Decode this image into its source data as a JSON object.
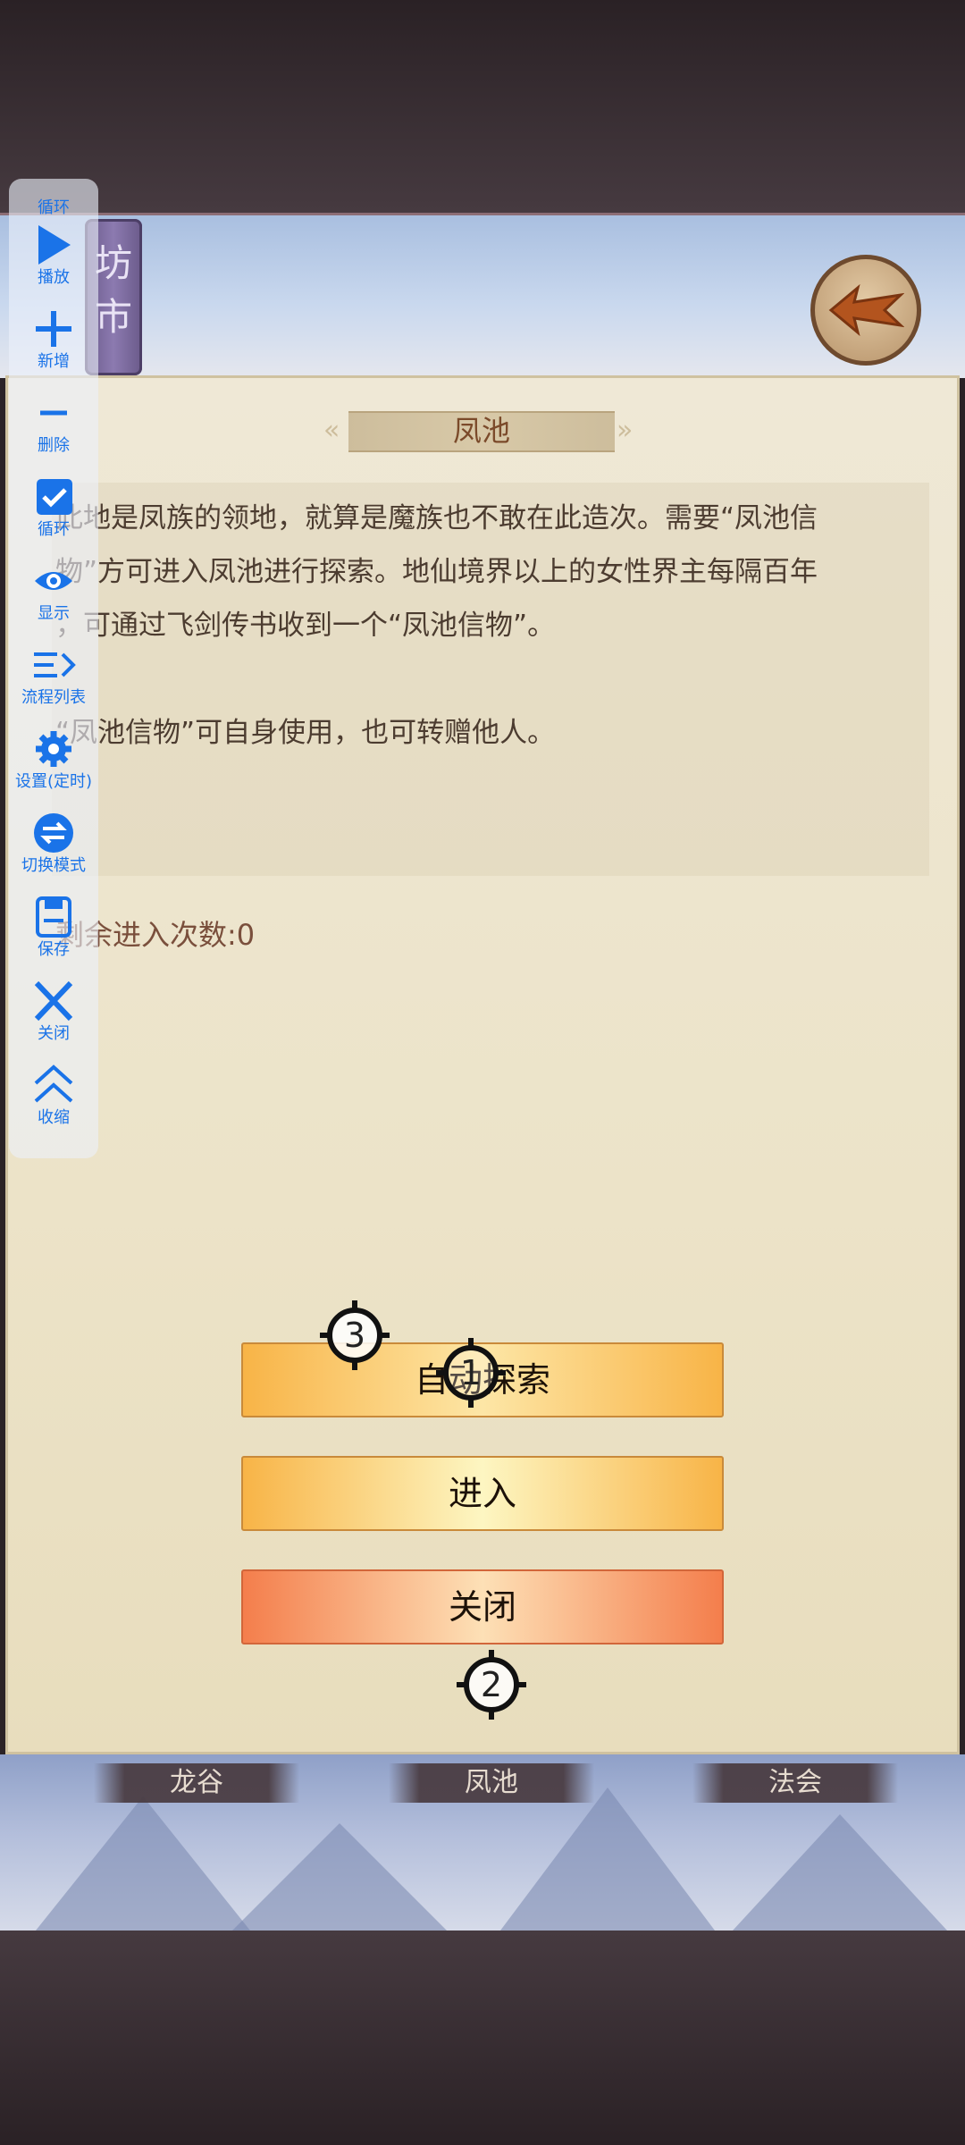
{
  "scene": {
    "shop_sign": [
      "坊",
      "市"
    ]
  },
  "panel": {
    "title": "凤池",
    "description_lines": [
      "此地是凤族的领地，就算是魔族也不敢在此造次。需要“凤池信",
      "物”方可进入凤池进行探索。地仙境界以上的女性界主每隔百年",
      "，可通过飞剑传书收到一个“凤池信物”。",
      "“凤池信物”可自身使用，也可转赠他人。"
    ],
    "remaining_label": "剩余进入次数:",
    "remaining_count": "0"
  },
  "buttons": {
    "auto_explore": "自动探索",
    "enter": "进入",
    "close": "关闭"
  },
  "markers": {
    "m1": "1",
    "m2": "2",
    "m3": "3"
  },
  "map_tabs": [
    "龙谷",
    "凤池",
    "法会"
  ],
  "toolbar": {
    "top_label": "循环",
    "items": [
      {
        "label": "播放",
        "icon": "play-icon"
      },
      {
        "label": "新增",
        "icon": "plus-icon"
      },
      {
        "label": "删除",
        "icon": "minus-icon"
      },
      {
        "label": "循环",
        "icon": "checkbox-icon"
      },
      {
        "label": "显示",
        "icon": "eye-icon"
      },
      {
        "label": "流程列表",
        "icon": "list-icon"
      },
      {
        "label": "设置(定时)",
        "icon": "gear-icon"
      },
      {
        "label": "切换模式",
        "icon": "switch-icon"
      },
      {
        "label": "保存",
        "icon": "save-icon"
      },
      {
        "label": "关闭",
        "icon": "close-icon"
      },
      {
        "label": "收缩",
        "icon": "collapse-icon"
      }
    ]
  },
  "colors": {
    "accent": "#1a73e8",
    "parchment": "#ece3c8",
    "button_gold": "#f8b447",
    "button_orange": "#f47e4c"
  }
}
